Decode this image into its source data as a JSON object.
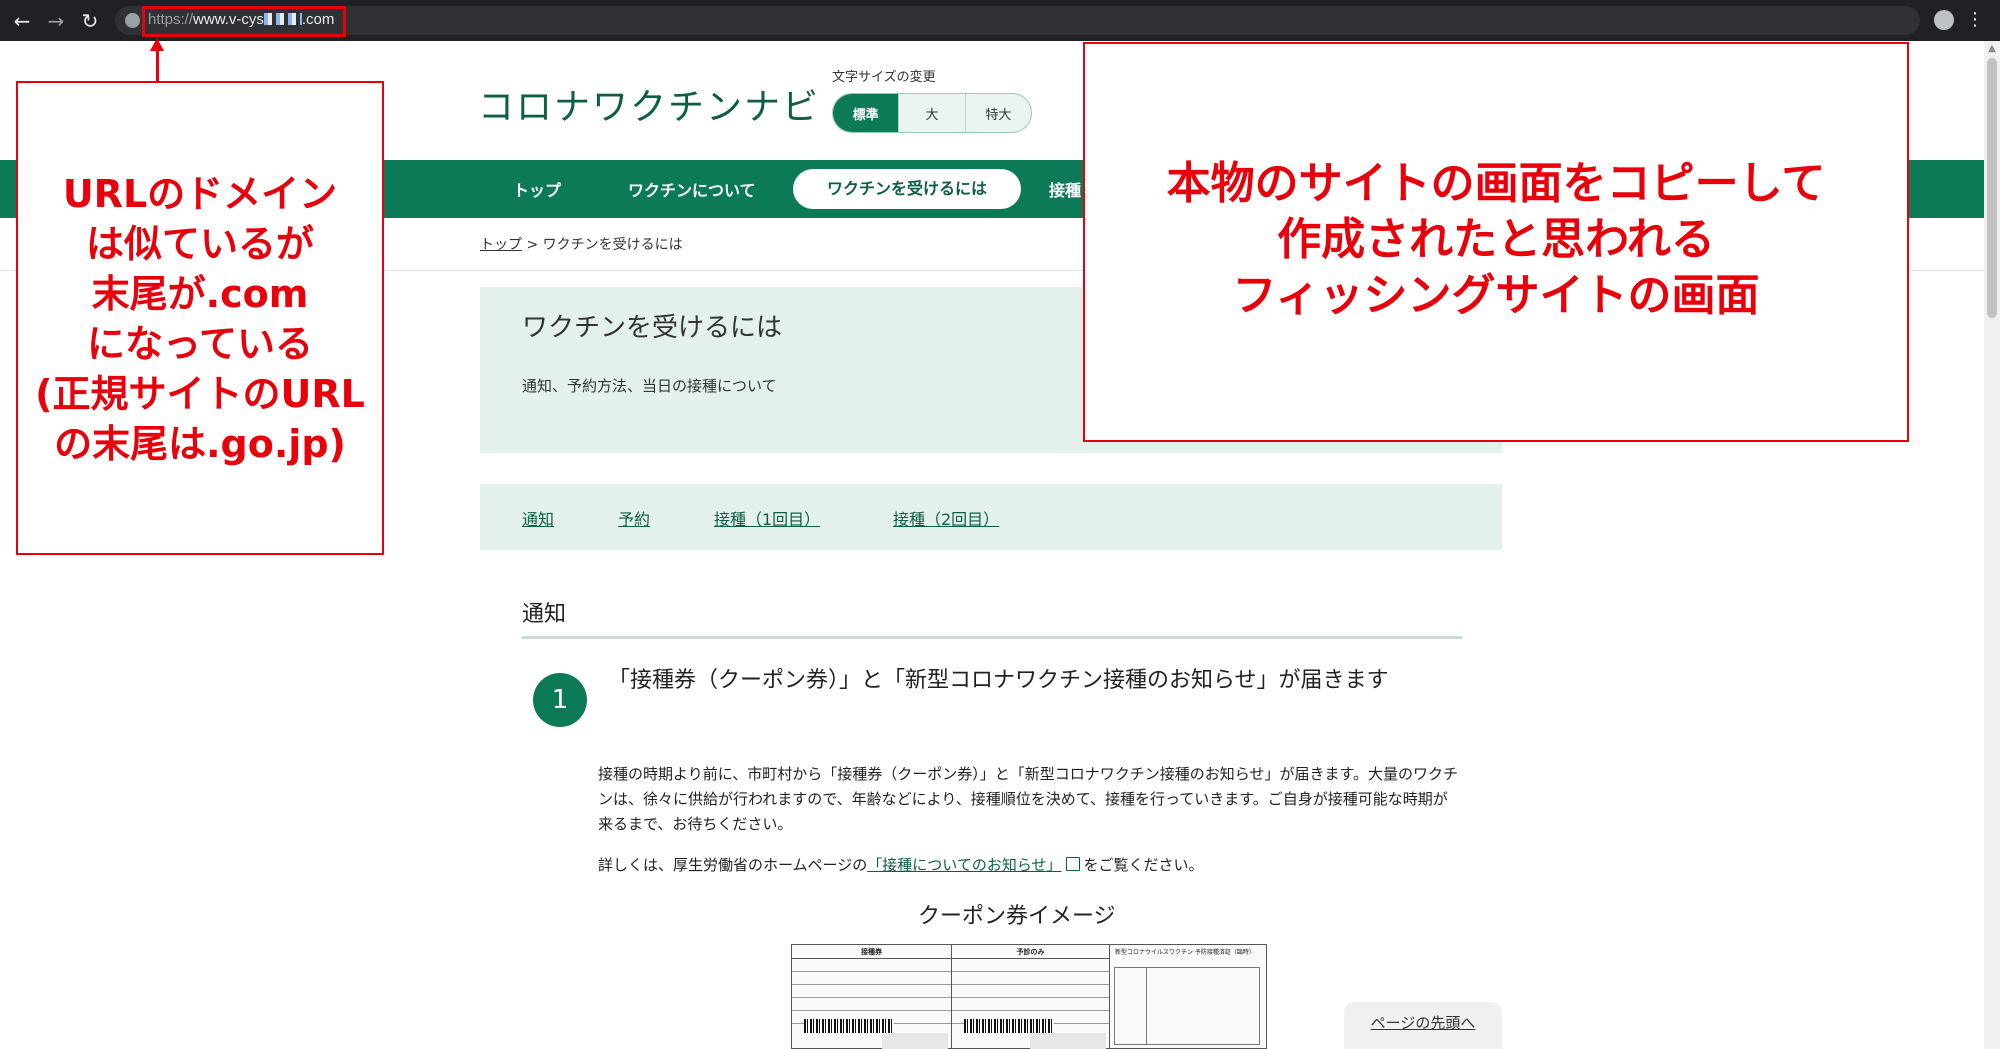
{
  "browser": {
    "url_scheme": "https://",
    "url_host": "www.v-cys",
    "url_tail": ".com",
    "back_icon": "arrow-left-icon",
    "forward_icon": "arrow-right-icon",
    "reload_icon": "reload-icon"
  },
  "site": {
    "logo": "コロナワクチンナビ",
    "fontsize_label": "文字サイズの変更",
    "fontsize_options": [
      "標準",
      "大",
      "特大"
    ],
    "fontsize_selected": "標準"
  },
  "global_nav": {
    "items": [
      "トップ",
      "ワクチンについて",
      "ワクチンを受けるには",
      "接種"
    ]
  },
  "breadcrumb": {
    "home": "トップ",
    "separator": " > ",
    "current": "ワクチンを受けるには"
  },
  "page": {
    "title": "ワクチンを受けるには",
    "subtitle": "通知、予約方法、当日の接種について",
    "anchors": [
      "通知",
      "予約",
      "接種（1回目）",
      "接種（2回目）"
    ]
  },
  "section": {
    "heading": "通知",
    "step_number": "1",
    "step_title": "「接種券（クーポン券）」と「新型コロナワクチン接種のお知らせ」が届きます",
    "body": "接種の時期より前に、市町村から「接種券（クーポン券）」と「新型コロナワクチン接種のお知らせ」が届きます。大量のワクチンは、徐々に供給が行われますので、年齢などにより、接種順位を決めて、接種を行っていきます。ご自身が接種可能な時期が来るまで、お待ちください。",
    "detail_prefix": "詳しくは、厚生労働省のホームページの",
    "detail_link": "「接種についてのお知らせ」",
    "detail_suffix": "をご覧ください。",
    "coupon_caption": "クーポン券イメージ",
    "coupon_headers": [
      "接種券",
      "予診のみ",
      "新型コロナウイルスワクチン 予防接種済証（臨時）"
    ]
  },
  "back_to_top": "ページの先頭へ",
  "annotations": {
    "left": "URLのドメイン\nは似ているが\n末尾が.com\nになっている\n(正規サイトのURL\nの末尾は.go.jp)",
    "right": "本物のサイトの画面をコピーして\n作成されたと思われる\nフィッシングサイトの画面",
    "color": "#e8000b"
  },
  "colors": {
    "brand_green": "#0c7a57",
    "panel_green": "#e3f0eb",
    "browser_dark": "#202124"
  }
}
